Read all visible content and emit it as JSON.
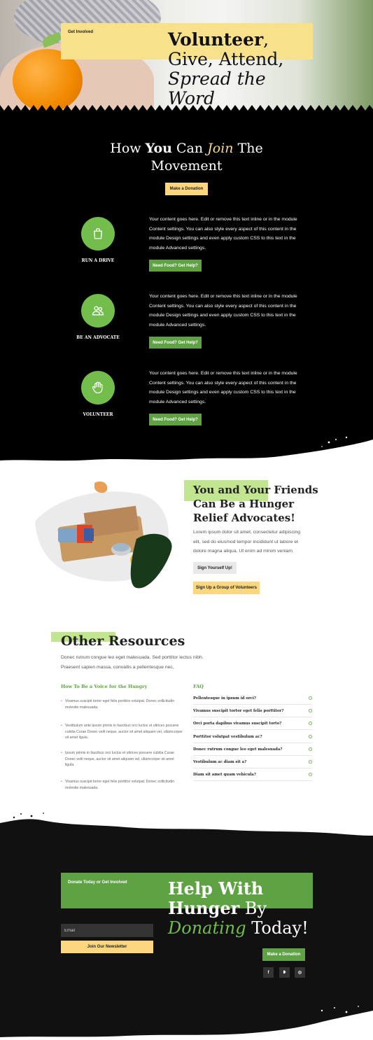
{
  "hero": {
    "label": "Get Involved",
    "title_bold": "Volunteer",
    "title_rest": ", Give, Attend, ",
    "title_italic": "Spread the Word"
  },
  "movement": {
    "title_pre": "How ",
    "title_bold": "You",
    "title_mid": " Can ",
    "title_italic": "Join",
    "title_post": " The Movement",
    "button": "Make a Donation"
  },
  "features": [
    {
      "label": "RUN A DRIVE",
      "icon": "shopping-bag-icon",
      "text": "Your content goes here. Edit or remove this text inline or in the module Content settings. You can also style every aspect of this content in the module Design settings and even apply custom CSS to this text in the module Advanced settings.",
      "button": "Need Food? Get Help?"
    },
    {
      "label": "BE AN ADVOCATE",
      "icon": "people-icon",
      "text": "Your content goes here. Edit or remove this text inline or in the module Content settings. You can also style every aspect of this content in the module Design settings and even apply custom CSS to this text in the module Advanced settings.",
      "button": "Need Food? Get Help?"
    },
    {
      "label": "VOLUNTEER",
      "icon": "raised-hand-icon",
      "text": "Your content goes here. Edit or remove this text inline or in the module Content settings. You can also style every aspect of this content in the module Design settings and even apply custom CSS to this text in the module Advanced settings.",
      "button": "Need Food? Get Help?"
    }
  ],
  "advocates": {
    "title": "You and Your Friends Can Be a Hunger Relief Advocates!",
    "text": "Lorem ipsum dolor sit amet, consectetur adipiscing elit, sed do eiusmod tempor incididunt ut labore et dolore magna aliqua. Ut enim ad minim veniam",
    "button1": "Sign Yourself Up!",
    "button2": "Sign Up a Group of Volunteers"
  },
  "resources": {
    "title": "Other Resources",
    "subtitle": "Donec rutrum congue leo eget malesuada. Sed porttitor lectus nibh. Praesent sapien massa, convallis a pellentesque nec,",
    "voice_heading": "How To Be a Voice for the Hungry",
    "bullets": [
      "Vivamus suscipit tortor eget felis porttitor volutpat. Donec sollicitudin molestie malesuada.",
      "Vestibulum ante ipsum primis in faucibus orci luctus et ultrices posuere cubilia Curae Donec velit neque, auctor sit amet aliquam vel, ullamcorper sit amet ligula.",
      "Ipsum primis in faucibus orci luctus et ultrices posuere cubilia Curae Donec velit neque, auctor sit amet aliquam vel, ullamcorper sit amet ligula.",
      "Vivamus suscipit tortor eget felis porttitor volutpat. Donec sollicitudin molestie malesuada."
    ],
    "faq_heading": "FAQ",
    "faq": [
      "Pellentesque in ipsum id orci?",
      "Vivamus suscipit tortor eget felis porttitor?",
      "Orci porta dapibus vivamus suscipit torto?",
      "Porttitor volutpat vestibulum ac?",
      "Donec rutrum congue leo eget malesuada?",
      "Vestibulum ac diam sit a?",
      "Diam sit amet quam vehicula?"
    ]
  },
  "footer": {
    "label": "Donate Today or Get Involved",
    "title_bold": "Help With Hunger",
    "title_mid": " By ",
    "title_italic": "Donating",
    "title_post": " Today!",
    "email_placeholder": "Email",
    "newsletter_button": "Join Our Newsletter",
    "donation_button": "Make a Donation",
    "social": [
      {
        "icon": "facebook-icon",
        "glyph": "f"
      },
      {
        "icon": "twitter-icon",
        "glyph": "❥"
      },
      {
        "icon": "instagram-icon",
        "glyph": "◎"
      }
    ]
  },
  "colors": {
    "accent_yellow": "#fcd780",
    "accent_green": "#5fa244",
    "light_green": "#c2e58f",
    "black": "#000000"
  }
}
